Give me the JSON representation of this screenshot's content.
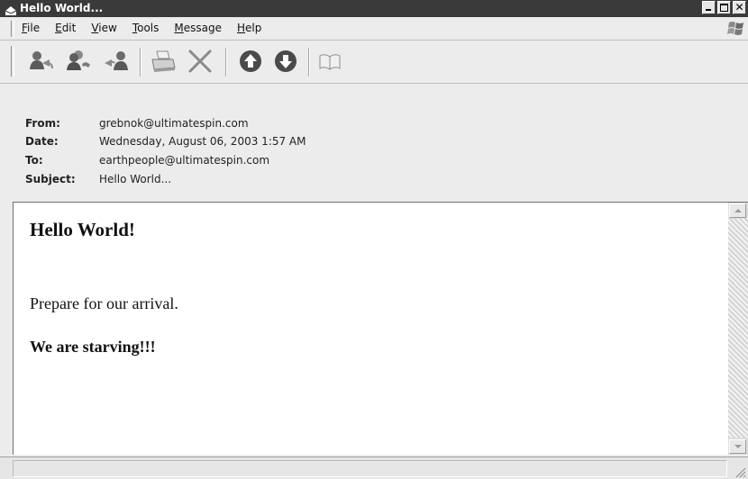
{
  "window": {
    "title": "Hello World..."
  },
  "menu": {
    "items": [
      {
        "label": "File",
        "mnemonic": "F",
        "rest": "ile"
      },
      {
        "label": "Edit",
        "mnemonic": "E",
        "rest": "dit"
      },
      {
        "label": "View",
        "mnemonic": "V",
        "rest": "iew"
      },
      {
        "label": "Tools",
        "mnemonic": "T",
        "rest": "ools"
      },
      {
        "label": "Message",
        "mnemonic": "M",
        "rest": "essage"
      },
      {
        "label": "Help",
        "mnemonic": "H",
        "rest": "elp"
      }
    ]
  },
  "toolbar": {
    "buttons": [
      "reply-icon",
      "reply-all-icon",
      "forward-icon",
      "print-icon",
      "delete-icon",
      "previous-icon",
      "next-icon",
      "addresses-icon"
    ]
  },
  "header": {
    "from_label": "From:",
    "from_value": "grebnok@ultimatespin.com",
    "date_label": "Date:",
    "date_value": "Wednesday, August 06, 2003 1:57 AM",
    "to_label": "To:",
    "to_value": "earthpeople@ultimatespin.com",
    "subject_label": "Subject:",
    "subject_value": "Hello World..."
  },
  "message": {
    "heading": "Hello World!",
    "paragraph": "Prepare for our arrival.",
    "bold_paragraph": "We are starving!!!"
  },
  "colors": {
    "titlebar": "#3a3a3a",
    "chrome": "#ececec",
    "body_bg": "#ffffff"
  }
}
